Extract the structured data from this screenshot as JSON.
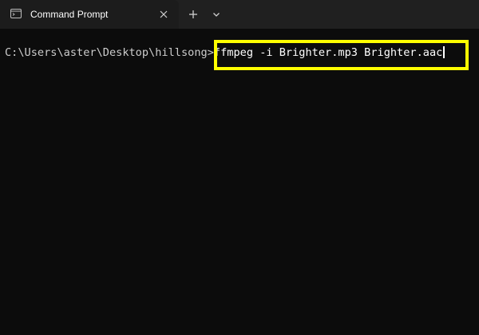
{
  "tab": {
    "title": "Command Prompt",
    "icon": "terminal-icon",
    "close_icon": "close-icon"
  },
  "toolbar": {
    "new_tab_icon": "plus-icon",
    "dropdown_icon": "chevron-down-icon"
  },
  "terminal": {
    "prompt": "C:\\Users\\aster\\Desktop\\hillsong>",
    "command": "ffmpeg -i Brighter.mp3 Brighter.aac"
  },
  "colors": {
    "background": "#0c0c0c",
    "titlebar": "#202020",
    "tab": "#1c1c1c",
    "prompt_text": "#cccccc",
    "highlight": "#ffff00"
  }
}
